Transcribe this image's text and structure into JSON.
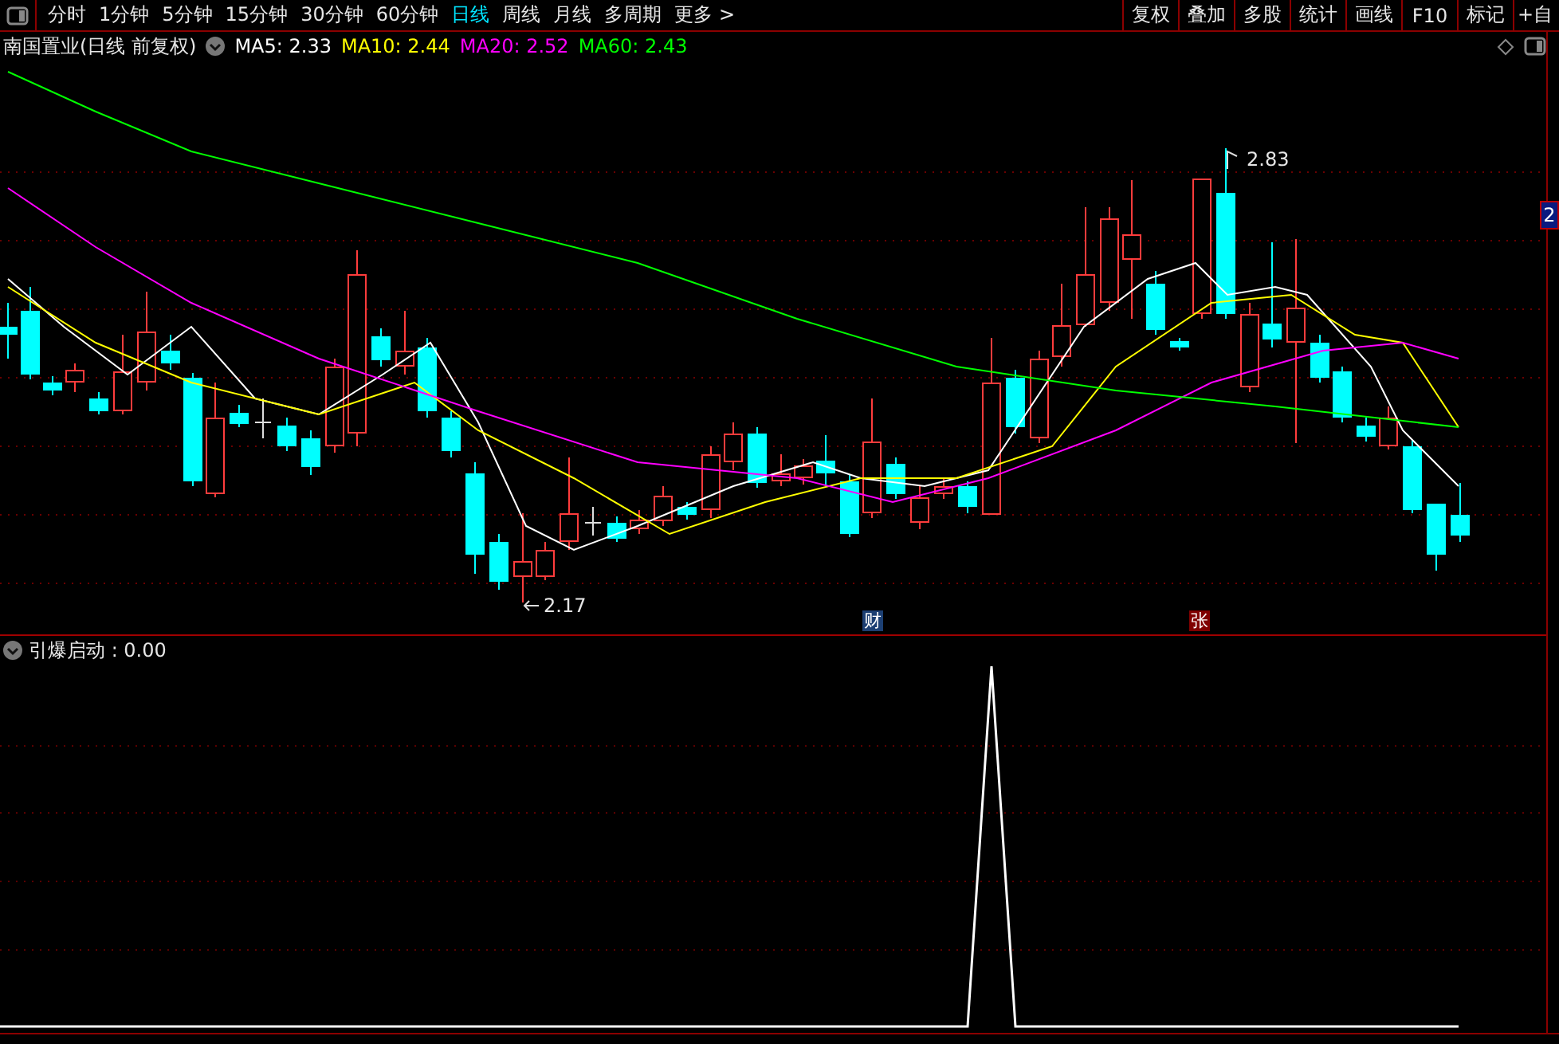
{
  "toolbar": {
    "periods": [
      {
        "label": "分时",
        "selected": false
      },
      {
        "label": "1分钟",
        "selected": false
      },
      {
        "label": "5分钟",
        "selected": false
      },
      {
        "label": "15分钟",
        "selected": false
      },
      {
        "label": "30分钟",
        "selected": false
      },
      {
        "label": "60分钟",
        "selected": false
      },
      {
        "label": "日线",
        "selected": true
      },
      {
        "label": "周线",
        "selected": false
      },
      {
        "label": "月线",
        "selected": false
      },
      {
        "label": "多周期",
        "selected": false
      }
    ],
    "more": "更多 >",
    "buttons": [
      "复权",
      "叠加",
      "多股",
      "统计",
      "画线",
      "F10",
      "标记",
      "+自"
    ]
  },
  "main_chart": {
    "title": "南国置业(日线 前复权)",
    "moving_averages": [
      {
        "label": "MA5: 2.33",
        "color": "#ffffff"
      },
      {
        "label": "MA10: 2.44",
        "color": "#ffff00"
      },
      {
        "label": "MA20: 2.52",
        "color": "#ff00ff"
      },
      {
        "label": "MA60: 2.43",
        "color": "#00ff00"
      }
    ],
    "high_label": "2.83",
    "low_label": "2.17",
    "event_badges": [
      {
        "label": "财",
        "color": "#1c3f73"
      },
      {
        "label": "张",
        "color": "#800000"
      }
    ],
    "axis_badge": "2"
  },
  "indicator_panel": {
    "title": "引爆启动 : 0.00"
  }
}
